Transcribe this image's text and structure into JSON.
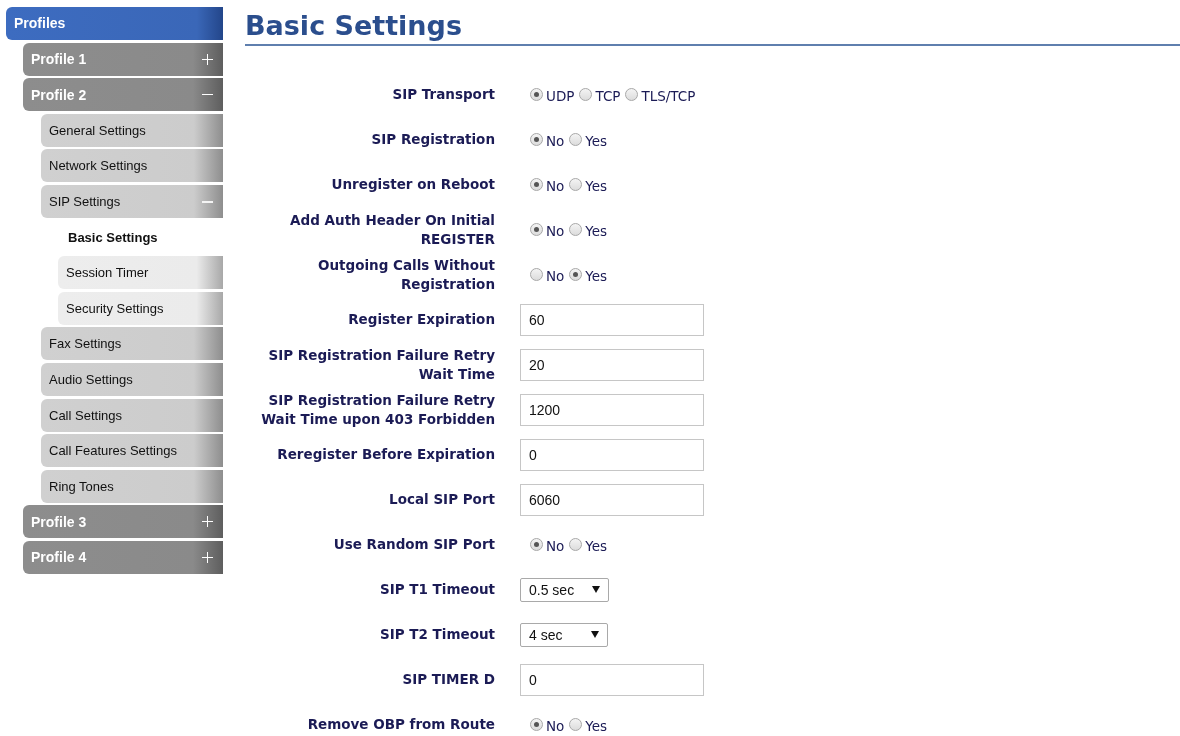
{
  "sidebar": {
    "header": "Profiles",
    "items": [
      {
        "label": "Profile 1",
        "expanded": false,
        "selected": false
      },
      {
        "label": "Profile 2",
        "expanded": true,
        "selected": false,
        "children": [
          {
            "label": "General Settings",
            "selected": false
          },
          {
            "label": "Network Settings",
            "selected": false
          },
          {
            "label": "SIP Settings",
            "expanded": true,
            "selected": false,
            "children": [
              {
                "label": "Basic Settings",
                "selected": true
              },
              {
                "label": "Session Timer",
                "selected": false
              },
              {
                "label": "Security Settings",
                "selected": false
              }
            ]
          },
          {
            "label": "Fax Settings",
            "selected": false
          },
          {
            "label": "Audio Settings",
            "selected": false
          },
          {
            "label": "Call Settings",
            "selected": false
          },
          {
            "label": "Call Features Settings",
            "selected": false
          },
          {
            "label": "Ring Tones",
            "selected": false
          }
        ]
      },
      {
        "label": "Profile 3",
        "expanded": false,
        "selected": false
      },
      {
        "label": "Profile 4",
        "expanded": false,
        "selected": false
      }
    ]
  },
  "page_title": "Basic Settings",
  "fields": [
    {
      "kind": "radio",
      "label": "SIP Transport",
      "options": [
        {
          "label": "UDP",
          "selected": true
        },
        {
          "label": "TCP",
          "selected": false
        },
        {
          "label": "TLS/TCP",
          "selected": false
        }
      ]
    },
    {
      "kind": "radio",
      "label": "SIP Registration",
      "options": [
        {
          "label": "No",
          "selected": true
        },
        {
          "label": "Yes",
          "selected": false
        }
      ]
    },
    {
      "kind": "radio",
      "label": "Unregister on Reboot",
      "options": [
        {
          "label": "No",
          "selected": true
        },
        {
          "label": "Yes",
          "selected": false
        }
      ]
    },
    {
      "kind": "radio",
      "label": "Add Auth Header On Initial REGISTER",
      "options": [
        {
          "label": "No",
          "selected": true
        },
        {
          "label": "Yes",
          "selected": false
        }
      ]
    },
    {
      "kind": "radio",
      "label": "Outgoing Calls Without Registration",
      "options": [
        {
          "label": "No",
          "selected": false
        },
        {
          "label": "Yes",
          "selected": true
        }
      ]
    },
    {
      "kind": "text",
      "label": "Register Expiration",
      "value": "60"
    },
    {
      "kind": "text",
      "label": "SIP Registration Failure Retry Wait Time",
      "value": "20"
    },
    {
      "kind": "text",
      "label": "SIP Registration Failure Retry Wait Time upon 403 Forbidden",
      "value": "1200"
    },
    {
      "kind": "text",
      "label": "Reregister Before Expiration",
      "value": "0"
    },
    {
      "kind": "text",
      "label": "Local SIP Port",
      "value": "6060"
    },
    {
      "kind": "radio",
      "label": "Use Random SIP Port",
      "options": [
        {
          "label": "No",
          "selected": true
        },
        {
          "label": "Yes",
          "selected": false
        }
      ]
    },
    {
      "kind": "select",
      "label": "SIP T1 Timeout",
      "value": "0.5 sec"
    },
    {
      "kind": "select",
      "label": "SIP T2 Timeout",
      "value": "4 sec"
    },
    {
      "kind": "text",
      "label": "SIP TIMER D",
      "value": "0"
    },
    {
      "kind": "radio",
      "label": "Remove OBP from Route",
      "options": [
        {
          "label": "No",
          "selected": true
        },
        {
          "label": "Yes",
          "selected": false
        }
      ]
    }
  ]
}
